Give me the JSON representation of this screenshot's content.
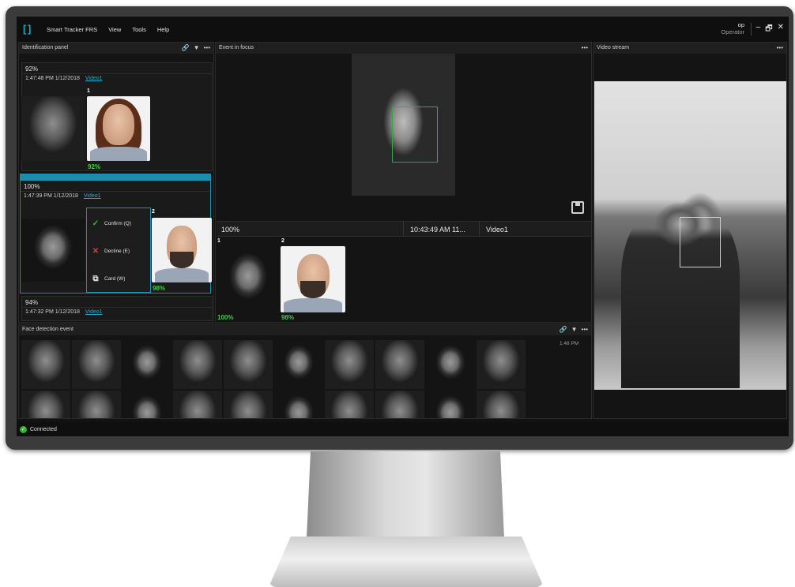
{
  "app": {
    "title": "Smart Tracker FRS",
    "menu": [
      "View",
      "Tools",
      "Help"
    ],
    "user": {
      "name": "op",
      "role": "Operator"
    }
  },
  "window_controls": {
    "minimize": "–",
    "restore": "🗗",
    "close": "✕"
  },
  "identification_panel": {
    "title": "Identification panel",
    "tools": [
      "link-icon",
      "filter-icon",
      "more-icon"
    ],
    "cards": [
      {
        "score": "92%",
        "time": "1:47:48 PM",
        "date": "1/12/2018",
        "source": "Video1",
        "match_index": "1",
        "match_score": "92%"
      },
      {
        "score": "100%",
        "time": "1:47:39 PM",
        "date": "1/12/2018",
        "source": "Video1",
        "match_index": "2",
        "match_score": "98%"
      },
      {
        "score": "94%",
        "time": "1:47:32 PM",
        "date": "1/12/2018",
        "source": "Video1"
      }
    ],
    "context_menu": [
      {
        "label": "Confirm (Q)",
        "icon": "check-icon",
        "color": "#2fbf2f"
      },
      {
        "label": "Decline (E)",
        "icon": "x-icon",
        "color": "#e23b3b"
      },
      {
        "label": "Card (W)",
        "icon": "external-link-icon",
        "color": "#e0e0e0"
      }
    ]
  },
  "event_in_focus": {
    "title": "Event in focus",
    "row": {
      "score": "100%",
      "time": "10:43:49 AM  11...",
      "source": "Video1"
    },
    "faces": [
      {
        "index": "1",
        "score": "100%"
      },
      {
        "index": "2",
        "score": "98%"
      }
    ]
  },
  "video_stream": {
    "title": "Video stream"
  },
  "face_detection": {
    "title": "Face detection event",
    "time": "1:48 PM",
    "thumbnail_count": 10
  },
  "status": {
    "label": "Connected",
    "color": "#2eb52e"
  }
}
